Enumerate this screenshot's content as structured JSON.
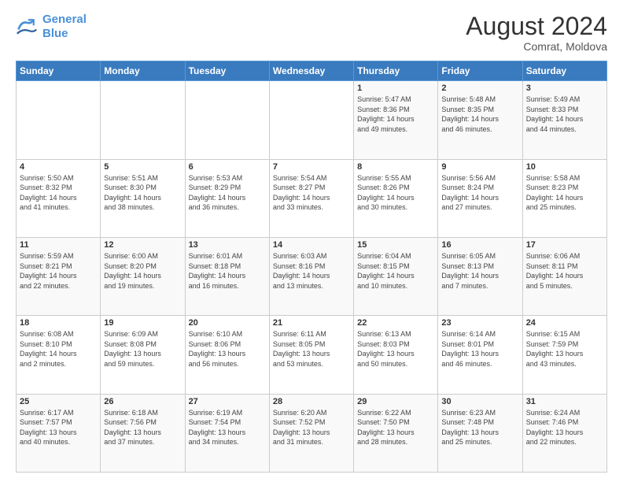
{
  "logo": {
    "line1": "General",
    "line2": "Blue"
  },
  "title": "August 2024",
  "subtitle": "Comrat, Moldova",
  "days_header": [
    "Sunday",
    "Monday",
    "Tuesday",
    "Wednesday",
    "Thursday",
    "Friday",
    "Saturday"
  ],
  "weeks": [
    [
      {
        "day": "",
        "info": ""
      },
      {
        "day": "",
        "info": ""
      },
      {
        "day": "",
        "info": ""
      },
      {
        "day": "",
        "info": ""
      },
      {
        "day": "1",
        "info": "Sunrise: 5:47 AM\nSunset: 8:36 PM\nDaylight: 14 hours\nand 49 minutes."
      },
      {
        "day": "2",
        "info": "Sunrise: 5:48 AM\nSunset: 8:35 PM\nDaylight: 14 hours\nand 46 minutes."
      },
      {
        "day": "3",
        "info": "Sunrise: 5:49 AM\nSunset: 8:33 PM\nDaylight: 14 hours\nand 44 minutes."
      }
    ],
    [
      {
        "day": "4",
        "info": "Sunrise: 5:50 AM\nSunset: 8:32 PM\nDaylight: 14 hours\nand 41 minutes."
      },
      {
        "day": "5",
        "info": "Sunrise: 5:51 AM\nSunset: 8:30 PM\nDaylight: 14 hours\nand 38 minutes."
      },
      {
        "day": "6",
        "info": "Sunrise: 5:53 AM\nSunset: 8:29 PM\nDaylight: 14 hours\nand 36 minutes."
      },
      {
        "day": "7",
        "info": "Sunrise: 5:54 AM\nSunset: 8:27 PM\nDaylight: 14 hours\nand 33 minutes."
      },
      {
        "day": "8",
        "info": "Sunrise: 5:55 AM\nSunset: 8:26 PM\nDaylight: 14 hours\nand 30 minutes."
      },
      {
        "day": "9",
        "info": "Sunrise: 5:56 AM\nSunset: 8:24 PM\nDaylight: 14 hours\nand 27 minutes."
      },
      {
        "day": "10",
        "info": "Sunrise: 5:58 AM\nSunset: 8:23 PM\nDaylight: 14 hours\nand 25 minutes."
      }
    ],
    [
      {
        "day": "11",
        "info": "Sunrise: 5:59 AM\nSunset: 8:21 PM\nDaylight: 14 hours\nand 22 minutes."
      },
      {
        "day": "12",
        "info": "Sunrise: 6:00 AM\nSunset: 8:20 PM\nDaylight: 14 hours\nand 19 minutes."
      },
      {
        "day": "13",
        "info": "Sunrise: 6:01 AM\nSunset: 8:18 PM\nDaylight: 14 hours\nand 16 minutes."
      },
      {
        "day": "14",
        "info": "Sunrise: 6:03 AM\nSunset: 8:16 PM\nDaylight: 14 hours\nand 13 minutes."
      },
      {
        "day": "15",
        "info": "Sunrise: 6:04 AM\nSunset: 8:15 PM\nDaylight: 14 hours\nand 10 minutes."
      },
      {
        "day": "16",
        "info": "Sunrise: 6:05 AM\nSunset: 8:13 PM\nDaylight: 14 hours\nand 7 minutes."
      },
      {
        "day": "17",
        "info": "Sunrise: 6:06 AM\nSunset: 8:11 PM\nDaylight: 14 hours\nand 5 minutes."
      }
    ],
    [
      {
        "day": "18",
        "info": "Sunrise: 6:08 AM\nSunset: 8:10 PM\nDaylight: 14 hours\nand 2 minutes."
      },
      {
        "day": "19",
        "info": "Sunrise: 6:09 AM\nSunset: 8:08 PM\nDaylight: 13 hours\nand 59 minutes."
      },
      {
        "day": "20",
        "info": "Sunrise: 6:10 AM\nSunset: 8:06 PM\nDaylight: 13 hours\nand 56 minutes."
      },
      {
        "day": "21",
        "info": "Sunrise: 6:11 AM\nSunset: 8:05 PM\nDaylight: 13 hours\nand 53 minutes."
      },
      {
        "day": "22",
        "info": "Sunrise: 6:13 AM\nSunset: 8:03 PM\nDaylight: 13 hours\nand 50 minutes."
      },
      {
        "day": "23",
        "info": "Sunrise: 6:14 AM\nSunset: 8:01 PM\nDaylight: 13 hours\nand 46 minutes."
      },
      {
        "day": "24",
        "info": "Sunrise: 6:15 AM\nSunset: 7:59 PM\nDaylight: 13 hours\nand 43 minutes."
      }
    ],
    [
      {
        "day": "25",
        "info": "Sunrise: 6:17 AM\nSunset: 7:57 PM\nDaylight: 13 hours\nand 40 minutes."
      },
      {
        "day": "26",
        "info": "Sunrise: 6:18 AM\nSunset: 7:56 PM\nDaylight: 13 hours\nand 37 minutes."
      },
      {
        "day": "27",
        "info": "Sunrise: 6:19 AM\nSunset: 7:54 PM\nDaylight: 13 hours\nand 34 minutes."
      },
      {
        "day": "28",
        "info": "Sunrise: 6:20 AM\nSunset: 7:52 PM\nDaylight: 13 hours\nand 31 minutes."
      },
      {
        "day": "29",
        "info": "Sunrise: 6:22 AM\nSunset: 7:50 PM\nDaylight: 13 hours\nand 28 minutes."
      },
      {
        "day": "30",
        "info": "Sunrise: 6:23 AM\nSunset: 7:48 PM\nDaylight: 13 hours\nand 25 minutes."
      },
      {
        "day": "31",
        "info": "Sunrise: 6:24 AM\nSunset: 7:46 PM\nDaylight: 13 hours\nand 22 minutes."
      }
    ]
  ]
}
